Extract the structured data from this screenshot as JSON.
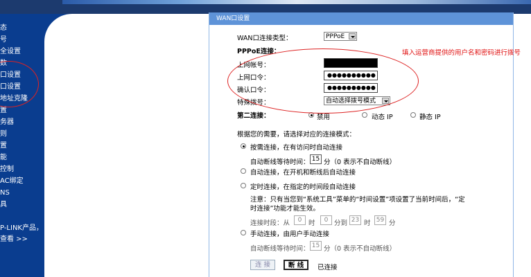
{
  "nav": {
    "items": [
      "态",
      "号",
      "全设置",
      "数",
      "口设置",
      "口设置",
      "地址克隆",
      "置",
      "务器",
      "则",
      "置",
      "能",
      "控制",
      "AC绑定",
      "NS",
      "具"
    ],
    "footer_line1": "P-LINK产品，",
    "footer_line2": "查看 >>"
  },
  "panel": {
    "title": "WAN口设置",
    "wan_type_label": "WAN口连接类型：",
    "wan_type_value": "PPPoE",
    "pppoe_label": "PPPoE连接：",
    "username_label": "上网帐号：",
    "username_value": "",
    "password_label": "上网口令：",
    "password_value": "●●●●●●●●●●",
    "confirm_label": "确认口令：",
    "confirm_value": "●●●●●●●●●●",
    "special_dial_label": "特殊拨号：",
    "special_dial_value": "自动选择拨号模式",
    "second_conn_label": "第二连接：",
    "second_opts": [
      "禁用",
      "动态 IP",
      "静态 IP"
    ],
    "mode_intro": "根据您的需要，请选择对应的连接模式：",
    "mode_ondemand": "按需连接，在有访问时自动连接",
    "idle_label": "自动断线等待时间：",
    "idle_value": "15",
    "idle_unit": "分（0 表示不自动断线）",
    "mode_auto": "自动连接，在开机和断线后自动连接",
    "mode_timed": "定时连接，在指定的时间段自动连接",
    "note_line1": "注意：只有当您到“系统工具”菜单的“时间设置”项设置了当前时间后，“定",
    "note_line2": "时连接”功能才能生效。",
    "period_label": "连接时段：从",
    "h1": "0",
    "m1": "0",
    "h2": "23",
    "m2": "59",
    "hour_unit": "时",
    "min_to": "分到",
    "min_unit": "分",
    "mode_manual": "手动连接，由用户手动连接",
    "idle2_label": "自动断线等待时间：",
    "idle2_value": "15",
    "idle2_unit": "分（0 表示不自动断线）",
    "connect_btn": "连 接",
    "disconnect_btn": "断 线",
    "status": "已连接"
  },
  "annotation": "填入运营商提供的用户名和密码进行拨号",
  "colors": {
    "sidebar": "#0a3d8f",
    "panel_header": "#5e93d8",
    "annotation": "#e01010"
  }
}
